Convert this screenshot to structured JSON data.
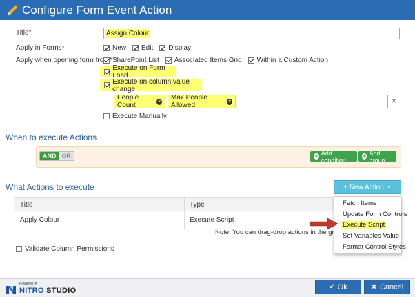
{
  "window": {
    "title": "Configure Form Event Action"
  },
  "form": {
    "title_label": "Title",
    "title_value": "Assign Colour",
    "apply_in_forms_label": "Apply in Forms",
    "apply_in_forms_options": [
      "New",
      "Edit",
      "Display"
    ],
    "apply_when_label": "Apply when opening form from",
    "apply_when_options": [
      "SharePoint List",
      "Associated Items Grid",
      "Within a Custom Action"
    ],
    "execute_on_form_load": "Execute on Form Load",
    "execute_on_column_change": "Execute on column value change",
    "columns": [
      "People Count",
      "Max People Allowed"
    ],
    "execute_manually": "Execute Manually",
    "asterisk": "*",
    "clear_glyph": "×"
  },
  "when": {
    "heading": "When to execute Actions",
    "and_label": "AND",
    "or_label": "OR",
    "add_condition": "Add condition",
    "add_group": "Add group"
  },
  "actions": {
    "heading": "What Actions to execute",
    "new_action": "+ New Action",
    "columns": [
      "Title",
      "Type"
    ],
    "rows": [
      {
        "title": "Apply Colour",
        "type": "Execute Script"
      }
    ],
    "note": "Note: You can drag-drop actions in the grid to"
  },
  "menu": {
    "items": [
      "Fetch Items",
      "Update Form Controls",
      "Execute Script",
      "Set Variables Value",
      "Format Control Styles"
    ],
    "highlighted": "Execute Script"
  },
  "validate_label": "Validate Column Permissions",
  "footer": {
    "powered_by": "Powered by",
    "brand_a": "NITRO",
    "brand_b": "STUDIO",
    "ok": "Ok",
    "cancel": "Cancel"
  },
  "colors": {
    "primary": "#2a6db5",
    "highlight": "#ffff73",
    "green": "#3fa34d",
    "info": "#5bc0de",
    "arrow": "#c0392b"
  }
}
